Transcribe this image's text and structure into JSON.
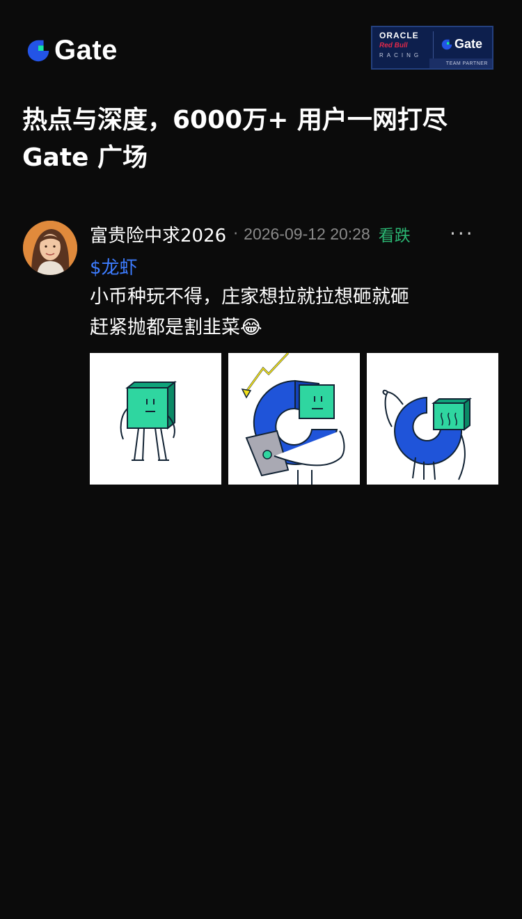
{
  "brand": {
    "name": "Gate",
    "accent": "#17e5a4",
    "blue": "#2354e6"
  },
  "partner": {
    "line1": "ORACLE",
    "line2": "Red Bull",
    "line3": "RACING",
    "gate": "Gate",
    "tag": "TEAM PARTNER"
  },
  "headline": {
    "line1": "热点与深度，6000万+ 用户一网打尽",
    "line2": "Gate 广场"
  },
  "post": {
    "username": "富贵险中求2026",
    "separator": "·",
    "timestamp": "2026-09-12 20:28",
    "sentiment": "看跌",
    "more": "···",
    "ticker": "$龙虾",
    "content_line1": "小币种玩不得，庄家想拉就拉想砸就砸",
    "content_line2": "赶紧抛都是割韭菜😂",
    "images": [
      "cube-character-standing",
      "cube-character-with-tablet-and-lightning",
      "cube-character-crying"
    ]
  }
}
